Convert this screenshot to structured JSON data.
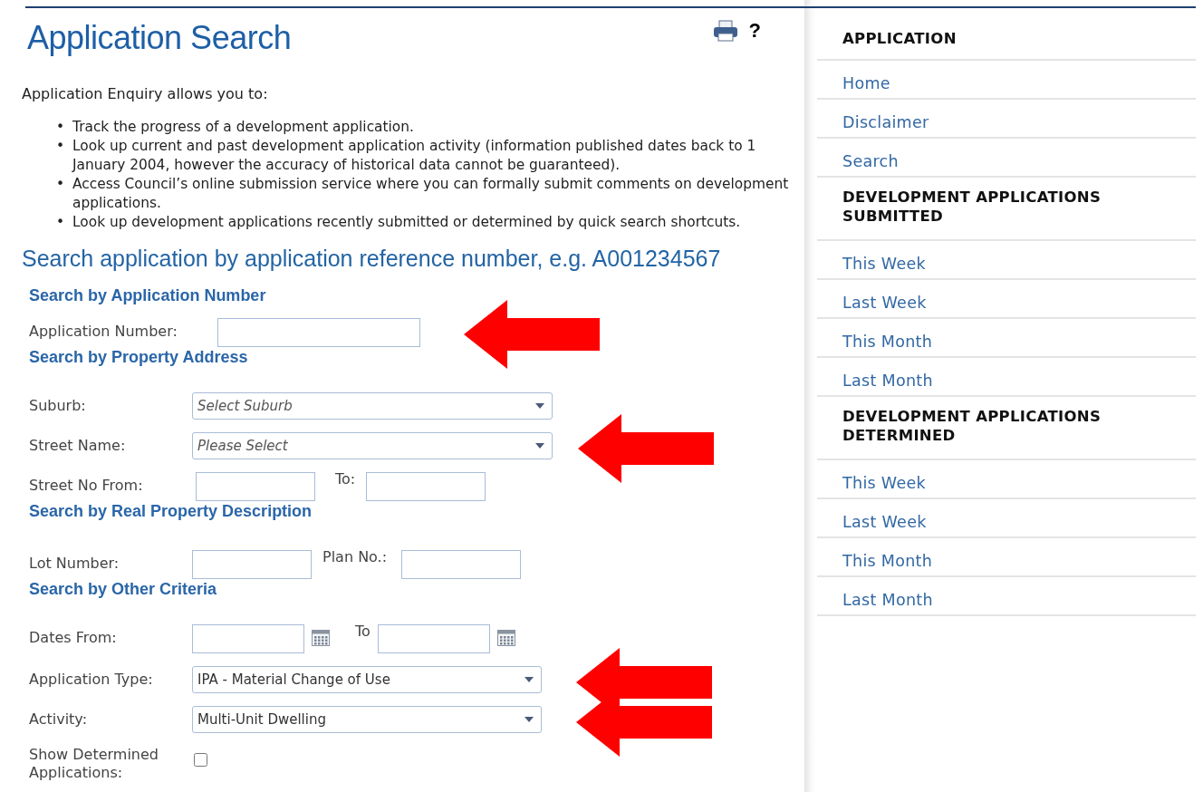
{
  "page": {
    "title": "Application Search",
    "help": "?"
  },
  "intro": {
    "text": "Application Enquiry allows you to:",
    "bullets": [
      {
        "marker": "•",
        "text": "Track the progress of a development application."
      },
      {
        "marker": "•",
        "text": "Look up current and past development application activity (information published dates back to 1 January 2004, however the accuracy of historical data cannot be guaranteed)."
      },
      {
        "marker": "•",
        "text": "Access Council’s online submission service where you can formally submit comments on development applications."
      },
      {
        "marker": "•",
        "text": "Look up development applications recently submitted or determined by quick search shortcuts."
      }
    ]
  },
  "search_heading": "Search application by application reference number, e.g. A001234567",
  "sections": [
    {
      "heading": "Search by Application Number",
      "rows": [
        {
          "kind": "text",
          "label": "Application Number:",
          "highlighted": true
        }
      ]
    },
    {
      "heading": "Search by Property Address",
      "rows": [
        {
          "kind": "select",
          "label": "Suburb:",
          "placeholder": "Select Suburb",
          "highlighted": false
        },
        {
          "kind": "select",
          "label": "Street Name:",
          "placeholder": "Please Select",
          "highlighted": true
        },
        {
          "kind": "pair",
          "label": "Street No From:",
          "second_label": "To:",
          "highlighted": false
        }
      ]
    },
    {
      "heading": "Search by Real Property Description",
      "rows": [
        {
          "kind": "pair",
          "label": "Lot Number:",
          "second_label": "Plan No.:",
          "highlighted": false
        }
      ]
    },
    {
      "heading": "Search by Other Criteria",
      "rows": [
        {
          "kind": "dates",
          "label": "Dates From:",
          "second_label": "To",
          "highlighted": false
        },
        {
          "kind": "select",
          "label": "Application Type:",
          "value": "IPA - Material Change of Use",
          "highlighted": true
        },
        {
          "kind": "select",
          "label": "Activity:",
          "value": "Multi-Unit Dwelling",
          "highlighted": true
        },
        {
          "kind": "checkbox",
          "label": "Show Determined Applications:",
          "checked": false
        }
      ]
    }
  ],
  "sidebar": {
    "items": [
      {
        "kind": "header",
        "label": "APPLICATION"
      },
      {
        "kind": "link",
        "label": "Home"
      },
      {
        "kind": "link",
        "label": "Disclaimer"
      },
      {
        "kind": "link",
        "label": "Search"
      },
      {
        "kind": "header",
        "label": "DEVELOPMENT APPLICATIONS SUBMITTED"
      },
      {
        "kind": "link",
        "label": "This Week"
      },
      {
        "kind": "link",
        "label": "Last Week"
      },
      {
        "kind": "link",
        "label": "This Month"
      },
      {
        "kind": "link",
        "label": "Last Month"
      },
      {
        "kind": "header",
        "label": "DEVELOPMENT APPLICATIONS DETERMINED"
      },
      {
        "kind": "link",
        "label": "This Week"
      },
      {
        "kind": "link",
        "label": "Last Week"
      },
      {
        "kind": "link",
        "label": "This Month"
      },
      {
        "kind": "link",
        "label": "Last Month"
      }
    ]
  }
}
